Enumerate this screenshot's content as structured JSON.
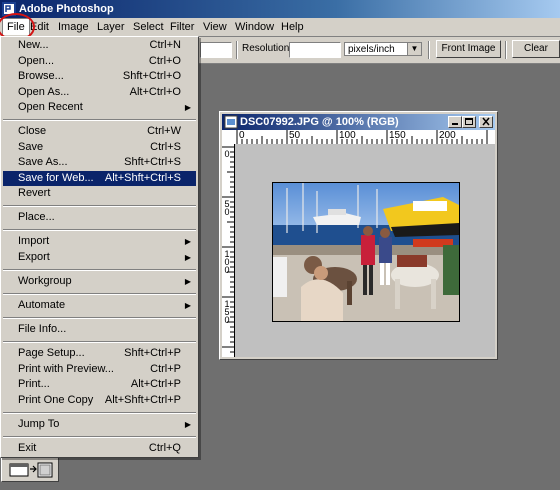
{
  "app": {
    "title": "Adobe Photoshop"
  },
  "menubar": {
    "items": [
      "File",
      "Edit",
      "Image",
      "Layer",
      "Select",
      "Filter",
      "View",
      "Window",
      "Help"
    ]
  },
  "options_bar": {
    "resolution_label": "Resolution:",
    "resolution_value": "",
    "unit_selected": "pixels/inch",
    "front_image_label": "Front Image",
    "clear_label": "Clear"
  },
  "file_menu": {
    "items": [
      {
        "label": "New...",
        "shortcut": "Ctrl+N"
      },
      {
        "label": "Open...",
        "shortcut": "Ctrl+O"
      },
      {
        "label": "Browse...",
        "shortcut": "Shft+Ctrl+O"
      },
      {
        "label": "Open As...",
        "shortcut": "Alt+Ctrl+O"
      },
      {
        "label": "Open Recent",
        "shortcut": "",
        "submenu": true
      },
      {
        "label": "Close",
        "shortcut": "Ctrl+W"
      },
      {
        "label": "Save",
        "shortcut": "Ctrl+S"
      },
      {
        "label": "Save As...",
        "shortcut": "Shft+Ctrl+S"
      },
      {
        "label": "Save for Web...",
        "shortcut": "Alt+Shft+Ctrl+S",
        "highlighted": true
      },
      {
        "label": "Revert",
        "shortcut": ""
      },
      {
        "label": "Place...",
        "shortcut": ""
      },
      {
        "label": "Import",
        "shortcut": "",
        "submenu": true
      },
      {
        "label": "Export",
        "shortcut": "",
        "submenu": true
      },
      {
        "label": "Workgroup",
        "shortcut": "",
        "submenu": true
      },
      {
        "label": "Automate",
        "shortcut": "",
        "submenu": true
      },
      {
        "label": "File Info...",
        "shortcut": ""
      },
      {
        "label": "Page Setup...",
        "shortcut": "Shft+Ctrl+P"
      },
      {
        "label": "Print with Preview...",
        "shortcut": "Ctrl+P"
      },
      {
        "label": "Print...",
        "shortcut": "Alt+Ctrl+P"
      },
      {
        "label": "Print One Copy",
        "shortcut": "Alt+Shft+Ctrl+P"
      },
      {
        "label": "Jump To",
        "shortcut": "",
        "submenu": true
      },
      {
        "label": "Exit",
        "shortcut": "Ctrl+Q"
      }
    ]
  },
  "document": {
    "title": "DSC07992.JPG @ 100% (RGB)",
    "ruler_top": [
      "0",
      "50",
      "100",
      "150",
      "200"
    ],
    "ruler_left": [
      "0",
      "5 0",
      "1 0 0",
      "1 5 0"
    ]
  },
  "colors": {
    "accent": "#0a246a",
    "highlight_circle": "#d21414",
    "menu_bg": "#d4d0c8"
  }
}
